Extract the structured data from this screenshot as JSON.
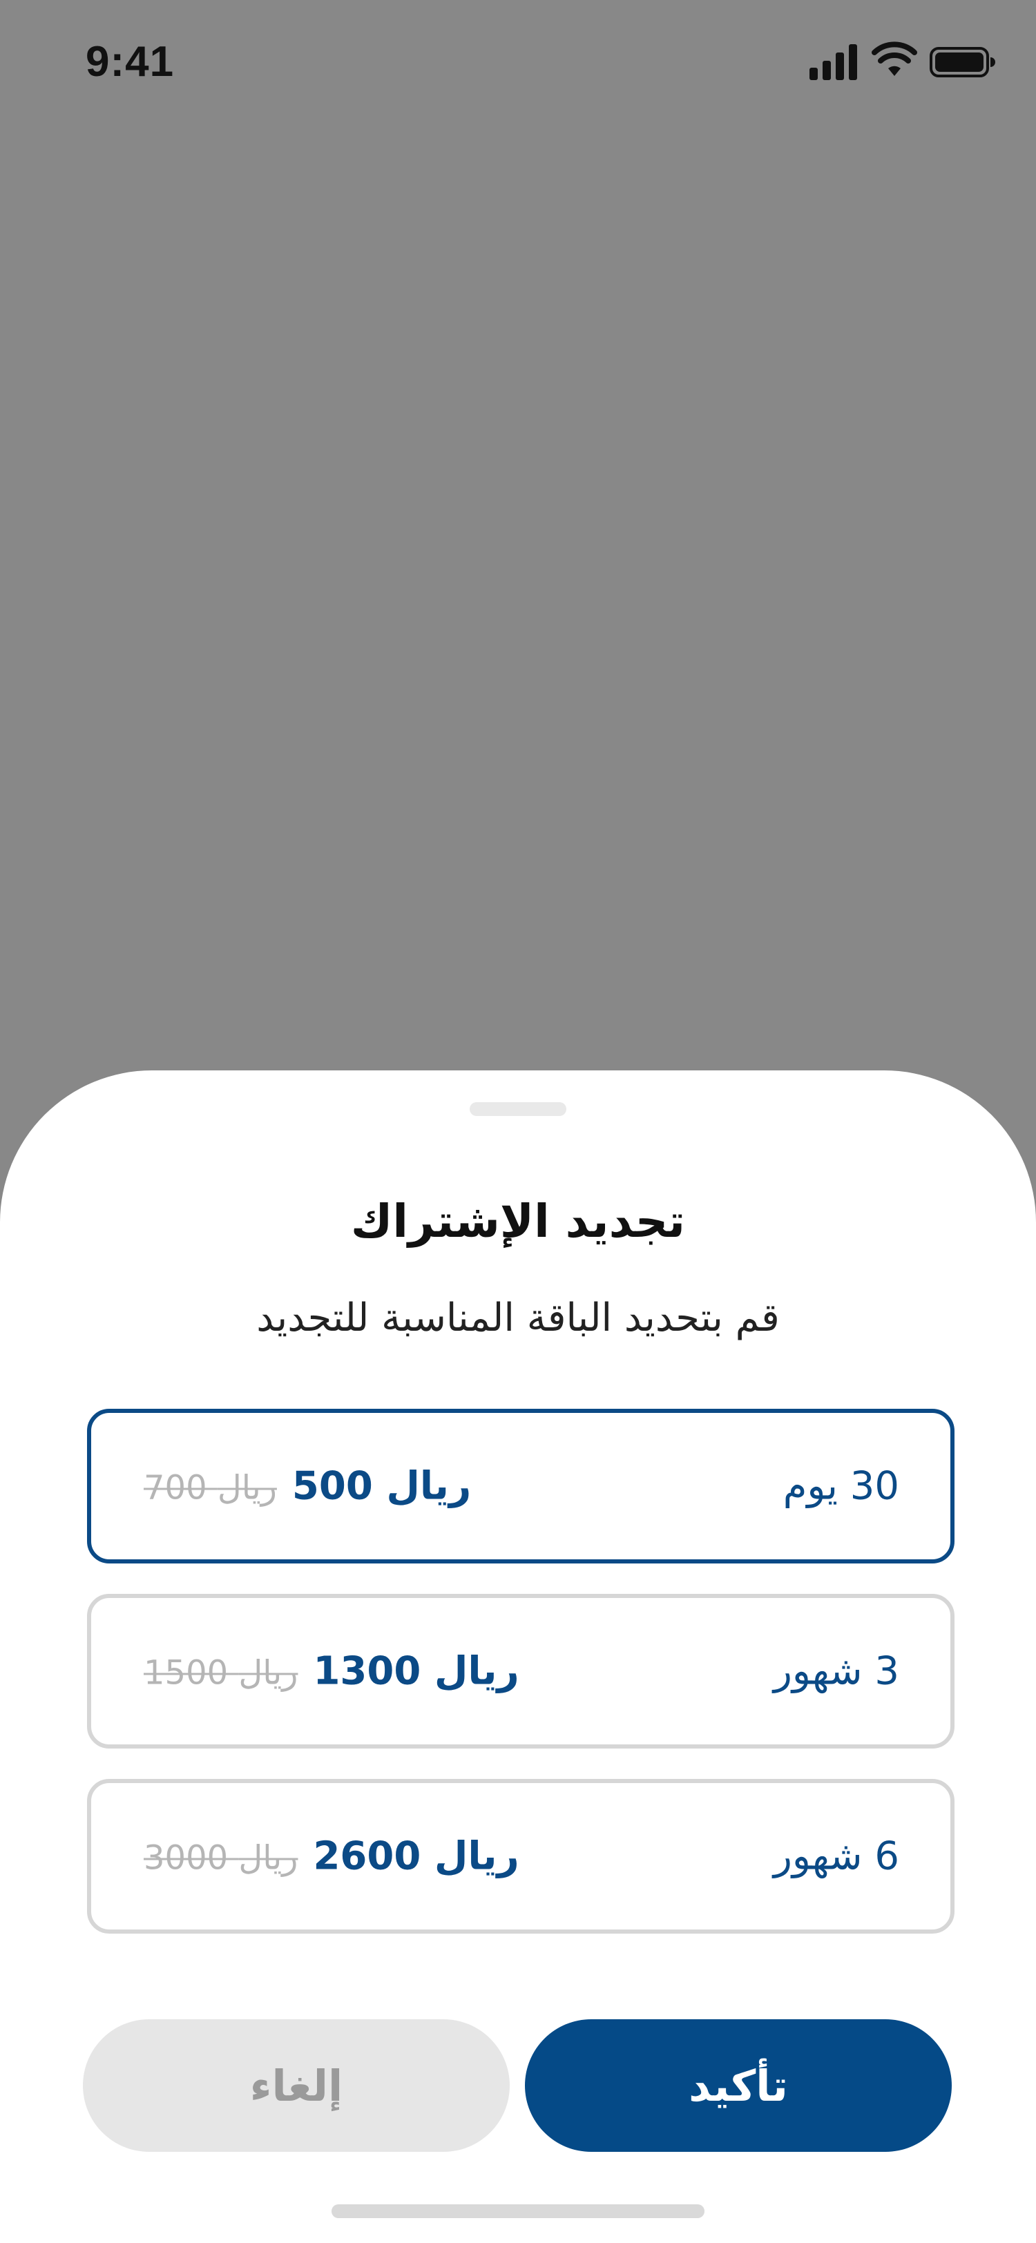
{
  "status_bar": {
    "time": "9:41",
    "icons": [
      "signal-icon",
      "wifi-icon",
      "battery-icon"
    ]
  },
  "sheet": {
    "title": "تجديد الإشتراك",
    "subtitle": "قم بتحديد الباقة المناسبة للتجديد",
    "plans": [
      {
        "duration": "30 يوم",
        "price": "500 ريال",
        "old_price": "700 ريال",
        "selected": true
      },
      {
        "duration": "3 شهور",
        "price": "1300 ريال",
        "old_price": "1500 ريال",
        "selected": false
      },
      {
        "duration": "6 شهور",
        "price": "2600 ريال",
        "old_price": "3000 ريال",
        "selected": false
      }
    ],
    "confirm_label": "تأكيد",
    "cancel_label": "إلغاء"
  },
  "colors": {
    "overlay": "#888888",
    "accent": "#0b4a86",
    "confirm_bg": "#054a87",
    "cancel_bg": "#e6e6e6",
    "border": "#d6d6d6",
    "muted_text": "#b5b5b5"
  }
}
